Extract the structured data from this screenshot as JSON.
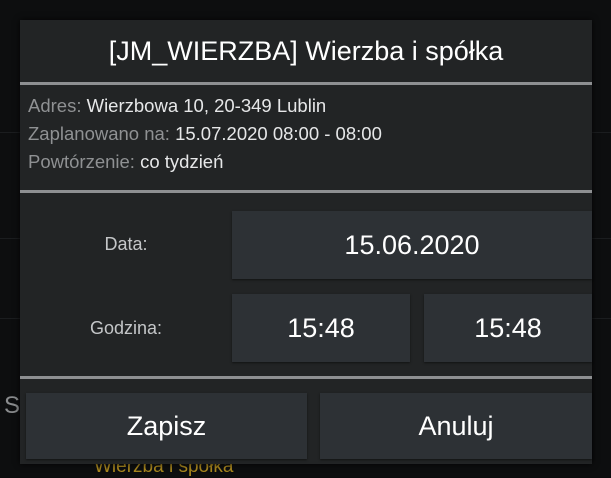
{
  "background": {
    "behind_text": "Wierzba i spółka",
    "edge_letter": "S"
  },
  "dialog": {
    "title": "[JM_WIERZBA] Wierzba i spółka",
    "info": {
      "address_label": "Adres:",
      "address_value": "Wierzbowa 10, 20-349 Lublin",
      "scheduled_label": "Zaplanowano na:",
      "scheduled_value": "15.07.2020 08:00 - 08:00",
      "repeat_label": "Powtórzenie:",
      "repeat_value": "co tydzień"
    },
    "form": {
      "date_label": "Data:",
      "date_value": "15.06.2020",
      "time_label": "Godzina:",
      "time_from": "15:48",
      "time_to": "15:48"
    },
    "buttons": {
      "save": "Zapisz",
      "cancel": "Anuluj"
    }
  },
  "colors": {
    "dialog_bg": "#222425",
    "field_bg": "#2d3135",
    "separator": "#8e9092",
    "label": "#8f9193",
    "accent_background_text": "#a8861e"
  }
}
